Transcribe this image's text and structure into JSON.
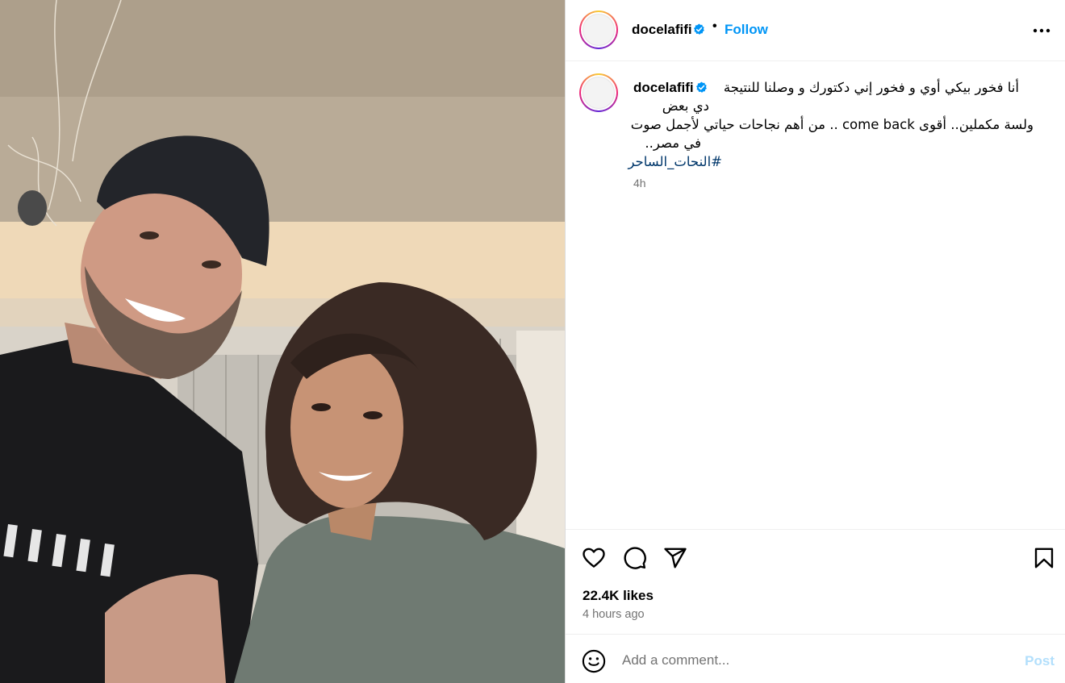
{
  "header": {
    "username": "docelafifi",
    "separator": "•",
    "follow_label": "Follow"
  },
  "caption": {
    "username": "docelafifi",
    "line1a": "أنا فخور بيكي أوي و فخور إني دكتورك و وصلنا للنتيجة",
    "line1b": "دي بعض",
    "line2": "ولسة مكملين.. أقوى come back .. من أهم نجاحات حياتي لأجمل صوت",
    "line3": "في مصر..",
    "hashtag": "#النحات_الساحر",
    "time": "4h"
  },
  "actions": {
    "likes": "22.4K likes",
    "posted": "4 hours ago"
  },
  "comment": {
    "placeholder": "Add a comment...",
    "post_label": "Post"
  },
  "icons": {
    "verified": "verified-badge-icon",
    "more": "more-horizontal-icon",
    "like": "heart-icon",
    "comment": "comment-bubble-icon",
    "share": "paper-plane-icon",
    "save": "bookmark-icon",
    "emoji": "smiley-icon"
  },
  "colors": {
    "follow": "#0095f6",
    "hashtag": "#00376b",
    "post_disabled": "#b2dffc",
    "secondary_text": "#737373",
    "verified": "#0095f6"
  }
}
